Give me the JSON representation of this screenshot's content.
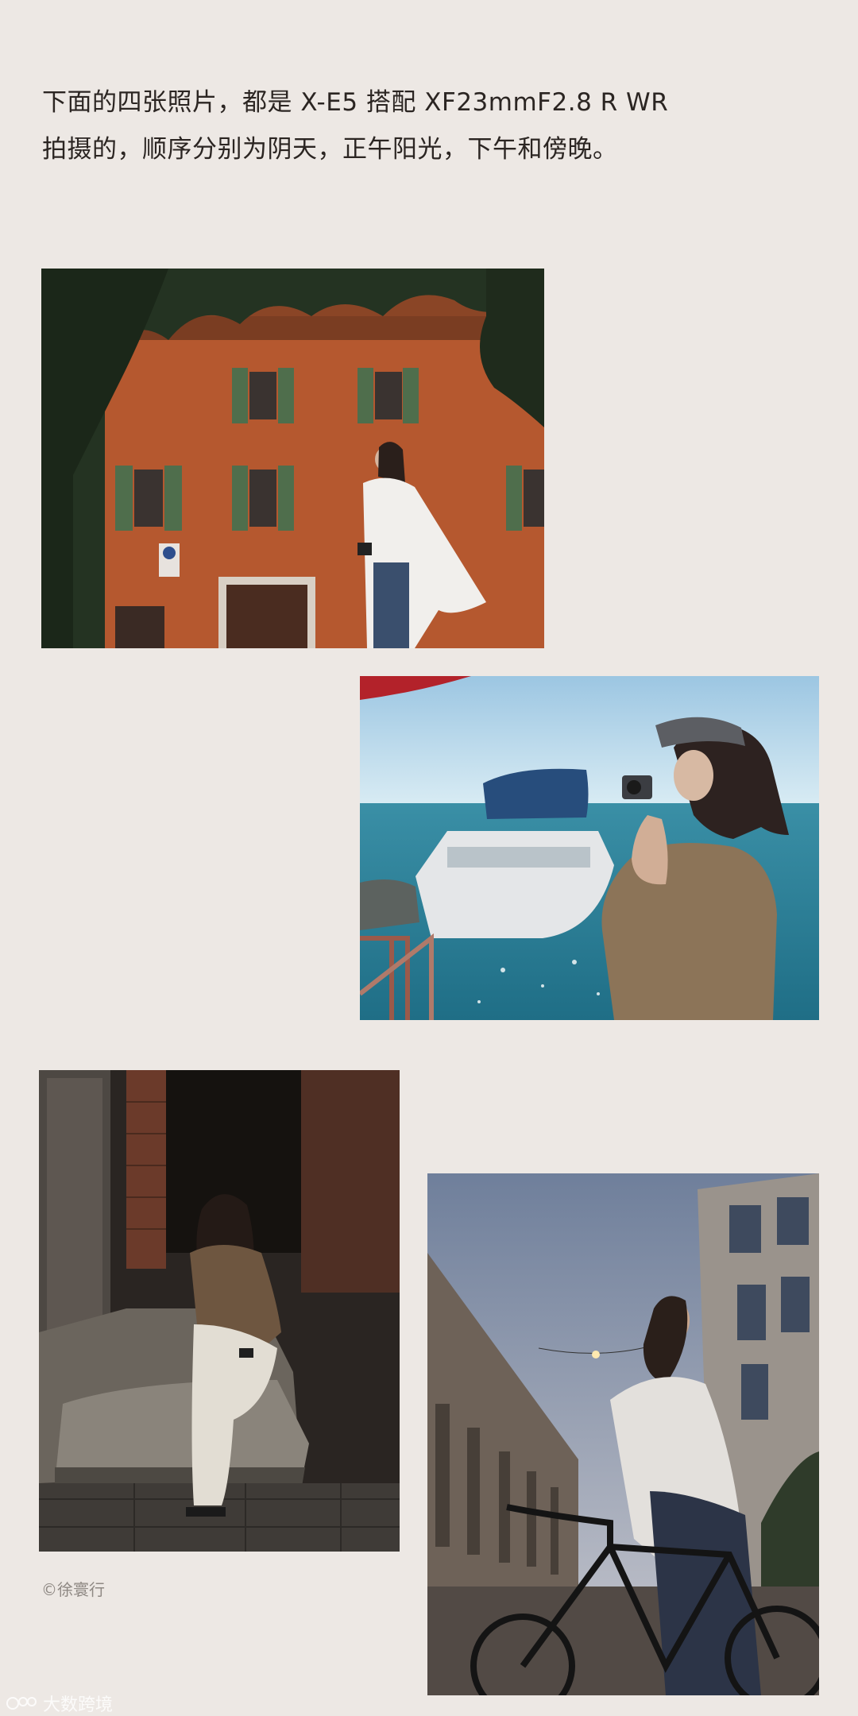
{
  "intro": {
    "line1": "下面的四张照片，都是 X-E5 搭配 XF23mmF2.8 R WR",
    "line2": "拍摄的，顺序分别为阴天，正午阳光，下午和傍晚。"
  },
  "photos": [
    {
      "scene": "overcast"
    },
    {
      "scene": "noon"
    },
    {
      "scene": "afternoon"
    },
    {
      "scene": "dusk"
    }
  ],
  "credit": "©徐寰行",
  "watermark": {
    "text": "大数跨境"
  },
  "colors": {
    "background": "#ede8e4",
    "text": "#2b2522",
    "credit": "#8f8984"
  }
}
